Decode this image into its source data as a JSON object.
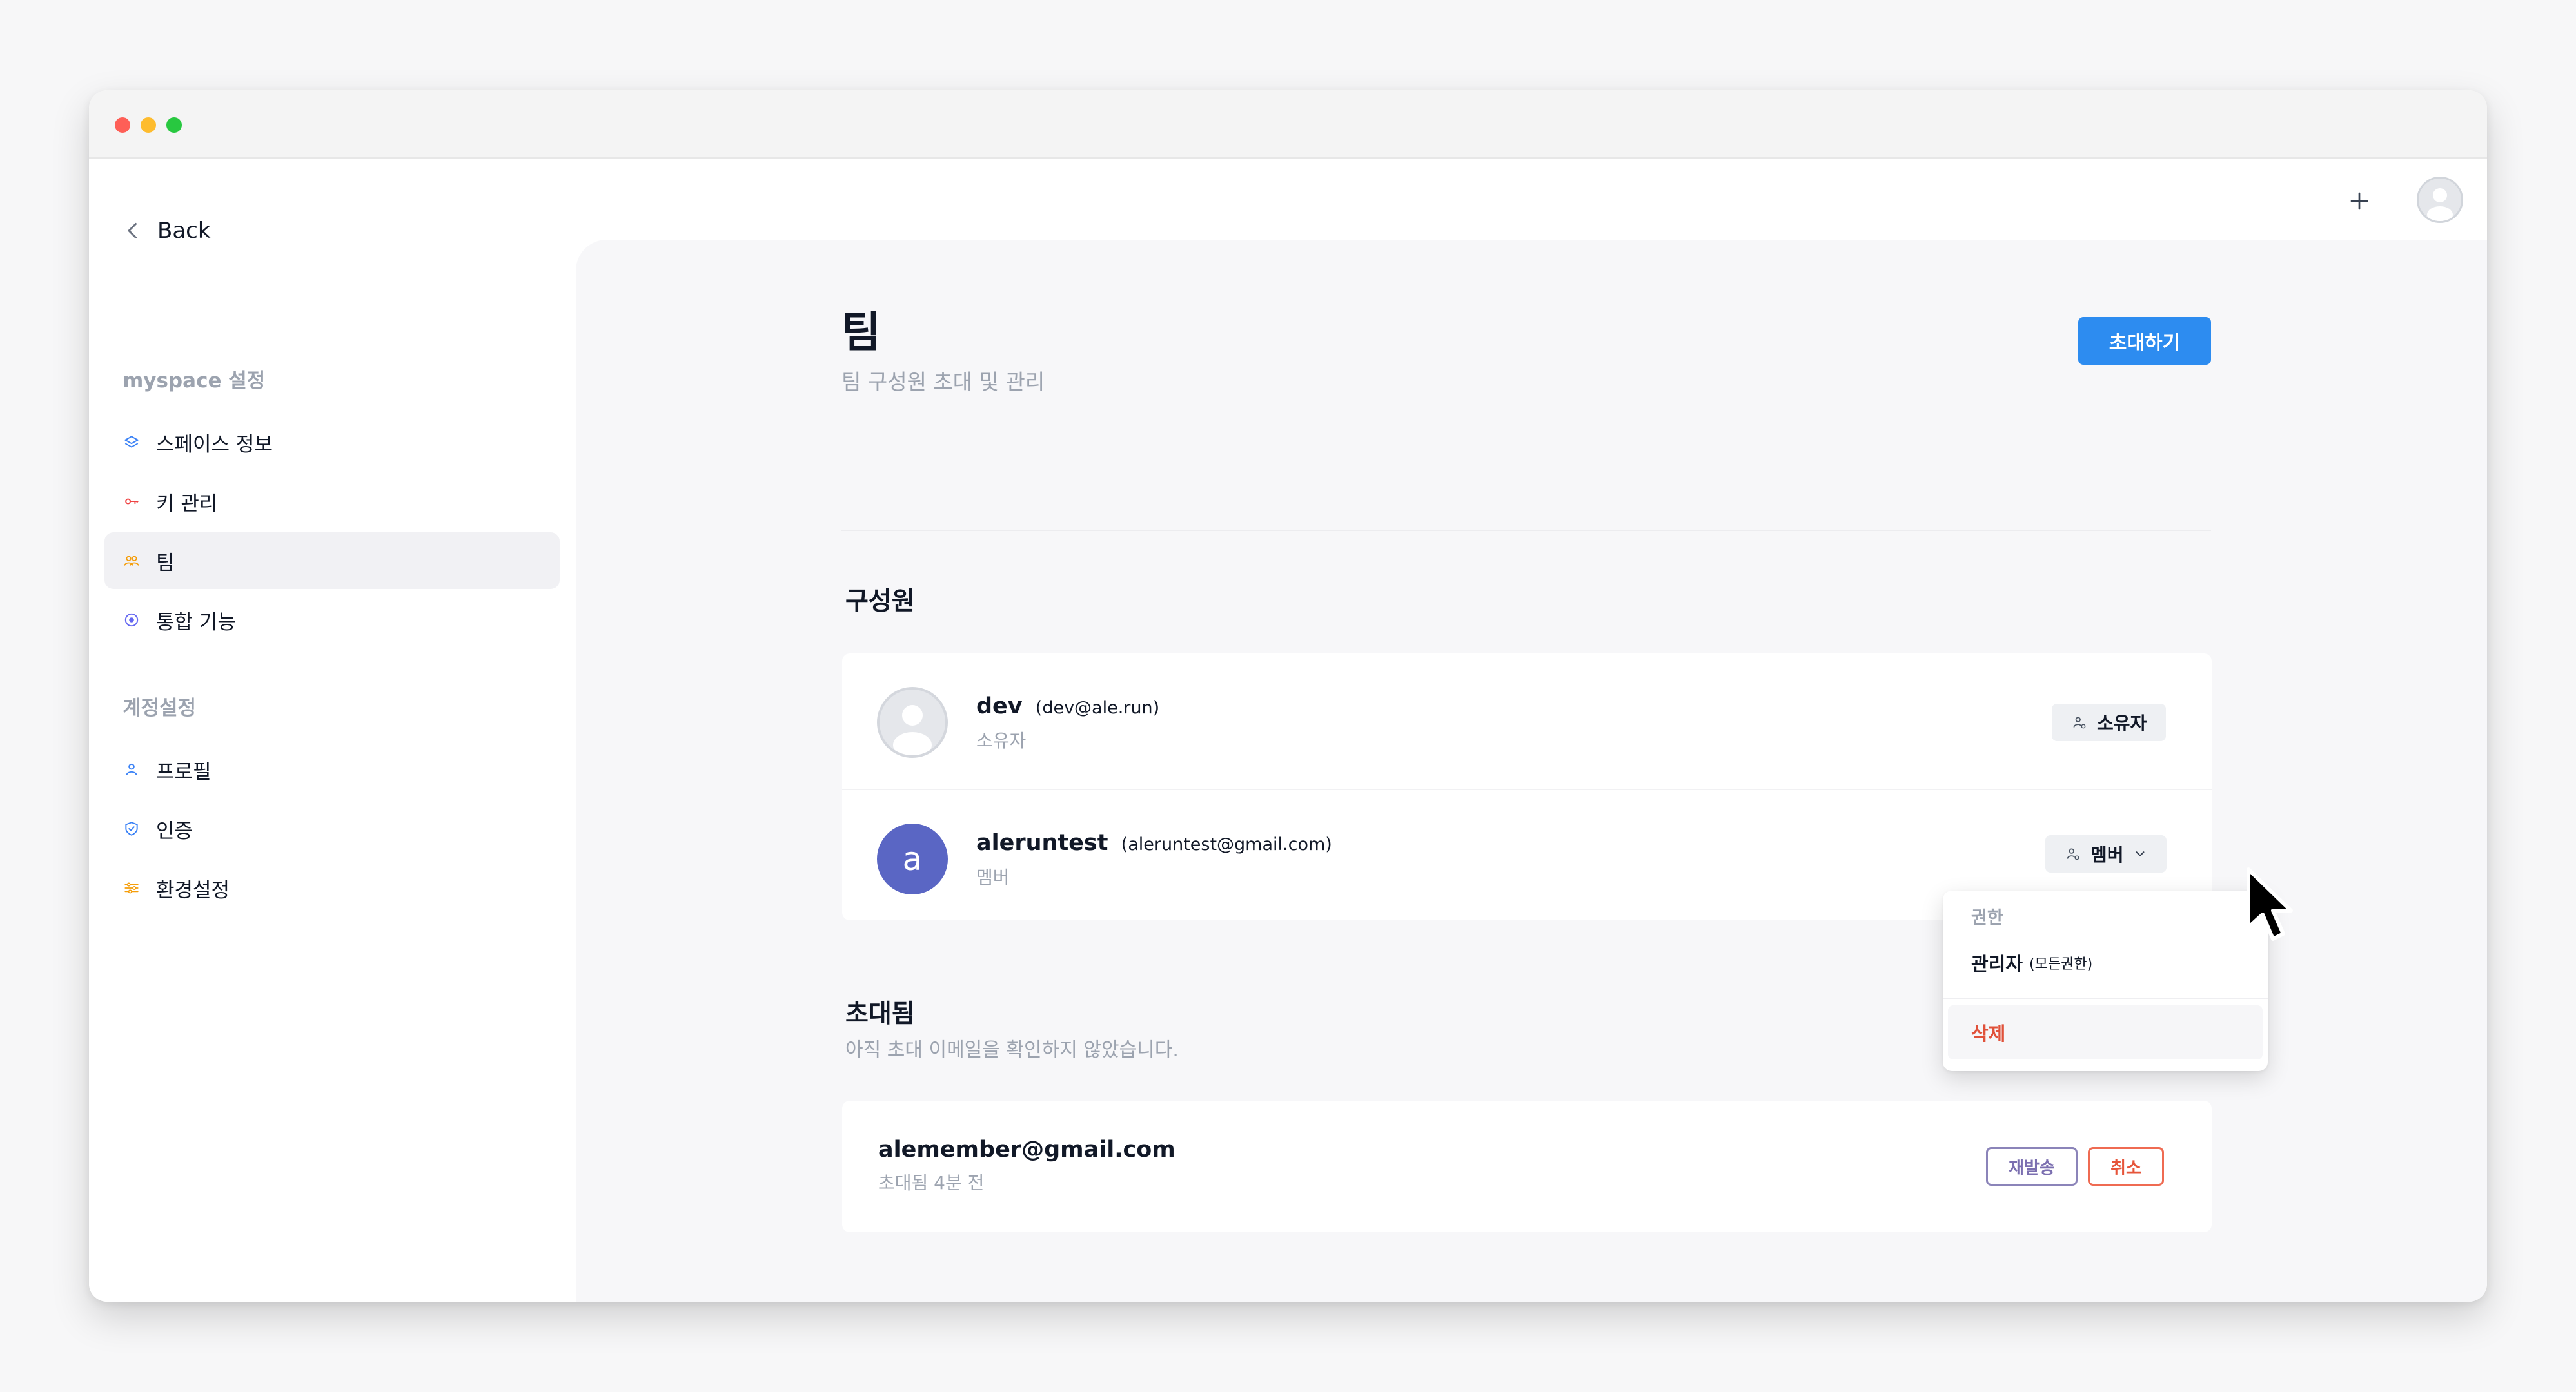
{
  "window": {
    "traffic_lights": {
      "close_color": "#fe5f57",
      "minimize_color": "#febc2e",
      "maximize_color": "#28c840"
    }
  },
  "topbar": {
    "back_label": "Back",
    "back_icon": "chevron-left-icon",
    "add_icon": "plus-icon",
    "avatar_icon": "user-avatar-icon"
  },
  "sidebar": {
    "workspace_section": "myspace 설정",
    "workspace_items": [
      {
        "label": "스페이스 정보",
        "icon": "layers-icon",
        "color": "#3b82f6"
      },
      {
        "label": "키 관리",
        "icon": "key-icon",
        "color": "#ef4444"
      },
      {
        "label": "팀",
        "icon": "team-icon",
        "color": "#f59e0b",
        "active": true
      },
      {
        "label": "통합 기능",
        "icon": "integration-icon",
        "color": "#6366f1"
      }
    ],
    "account_section": "계정설정",
    "account_items": [
      {
        "label": "프로필",
        "icon": "person-icon",
        "color": "#3b82f6"
      },
      {
        "label": "인증",
        "icon": "shield-icon",
        "color": "#3b82f6"
      },
      {
        "label": "환경설정",
        "icon": "sliders-icon",
        "color": "#f59e0b"
      }
    ]
  },
  "main": {
    "title": "팀",
    "subtitle": "팀 구성원 초대 및 관리",
    "invite_button": "초대하기",
    "accent_color": "#2d8cf0",
    "members_title": "구성원",
    "members": [
      {
        "name": "dev",
        "email": "(dev@ale.run)",
        "role": "소유자",
        "badge": "소유자",
        "avatar": "default-avatar-icon"
      },
      {
        "name": "aleruntest",
        "email": "(aleruntest@gmail.com)",
        "role": "멤버",
        "badge": "멤버",
        "avatar_letter": "a",
        "avatar_color": "#5a66c4"
      }
    ],
    "invited_title": "초대됨",
    "invited_subtitle": "아직 초대 이메일을 확인하지 않았습니다.",
    "invites": [
      {
        "email": "alemember@gmail.com",
        "time": "초대됨 4분 전",
        "resend_label": "재발송",
        "cancel_label": "취소"
      }
    ]
  },
  "role_menu": {
    "header": "권한",
    "admin_label": "관리자",
    "admin_sub": "(모든권한)",
    "delete_label": "삭제",
    "delete_color": "#e0513a"
  }
}
